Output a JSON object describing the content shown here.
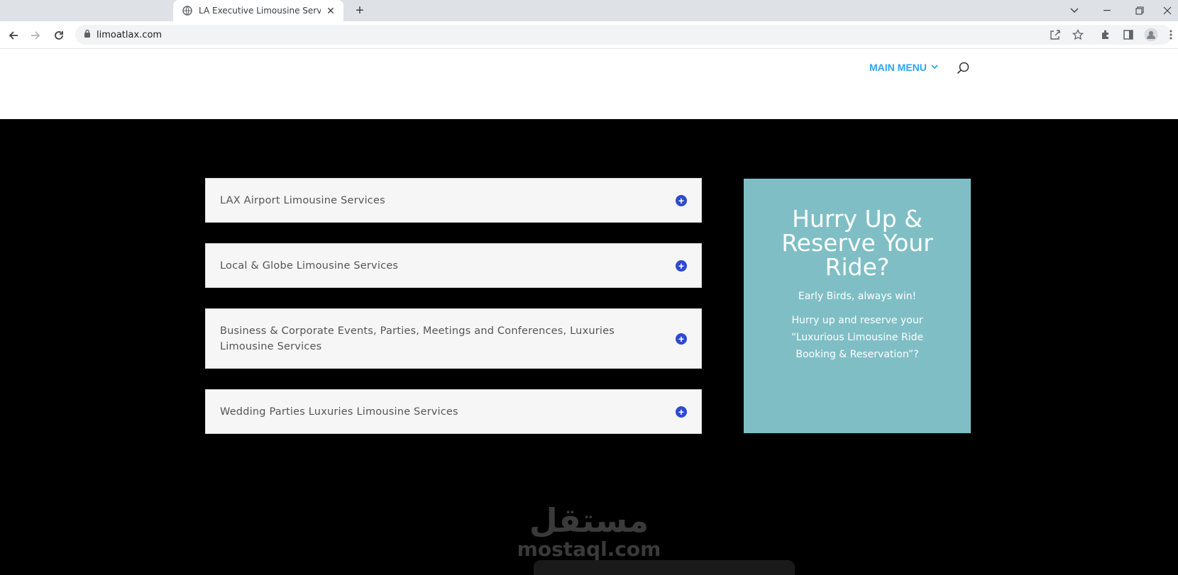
{
  "browser": {
    "tab_title": "LA Executive Limousine Services",
    "url": "limoatlax.com",
    "new_tab_label": "+"
  },
  "header": {
    "main_menu_label": "MAIN MENU"
  },
  "accordion": [
    {
      "title": "LAX Airport Limousine Services"
    },
    {
      "title": "Local & Globe Limousine Services"
    },
    {
      "title": "Business & Corporate Events, Parties, Meetings and Conferences, Luxuries Limousine Services"
    },
    {
      "title": "Wedding Parties Luxuries Limousine Services"
    }
  ],
  "cta": {
    "title": "Hurry Up & Reserve Your Ride?",
    "subtitle": "Early Birds, always win!",
    "body": "Hurry up and reserve your “Luxurious Limousine Ride Booking & Reservation”?"
  },
  "watermark": {
    "arabic": "مستقل",
    "latin": "mostaql.com"
  },
  "colors": {
    "accent": "#2ea3f2",
    "toggle_icon": "#2e4ad0",
    "cta_bg": "#7fbec5"
  }
}
